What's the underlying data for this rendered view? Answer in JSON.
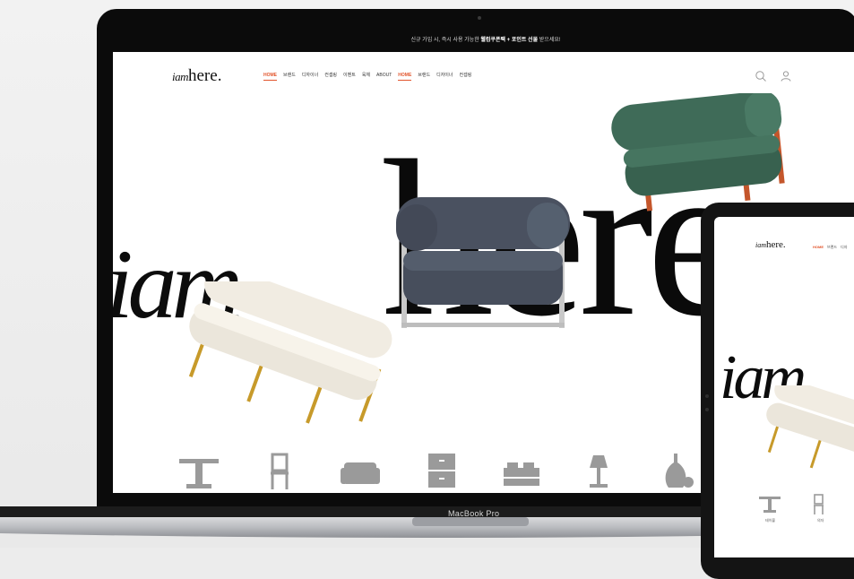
{
  "promo": {
    "text_prefix": "신규 가입 시, 즉시 사용 가능한 ",
    "text_bold": "웰컴쿠폰팩 + 포인트 선물",
    "text_suffix": " 받으세요!"
  },
  "nav": {
    "logo_script": "iam",
    "logo_serif": "here.",
    "items": [
      {
        "label": "HOME",
        "active": true
      },
      {
        "label": "브랜드",
        "active": false
      },
      {
        "label": "디자이너",
        "active": false
      },
      {
        "label": "컨셉링",
        "active": false
      },
      {
        "label": "이벤트",
        "active": false
      },
      {
        "label": "육체",
        "active": false
      },
      {
        "label": "ABOUT",
        "active": false
      },
      {
        "label": "HOME",
        "active": true
      },
      {
        "label": "브랜드",
        "active": false
      },
      {
        "label": "디자이너",
        "active": false
      },
      {
        "label": "컨셉링",
        "active": false
      }
    ],
    "icons": [
      "search-icon",
      "user-icon"
    ]
  },
  "hero": {
    "script_word": "iam",
    "big_word": "here"
  },
  "categories": [
    {
      "icon": "table-icon"
    },
    {
      "icon": "chair-icon"
    },
    {
      "icon": "sofa-icon"
    },
    {
      "icon": "cabinet-icon"
    },
    {
      "icon": "bed-icon"
    },
    {
      "icon": "lamp-icon"
    },
    {
      "icon": "vase-icon"
    }
  ],
  "device": {
    "laptop_label": "MacBook Pro"
  },
  "tablet": {
    "logo_script": "iam",
    "logo_serif": "here.",
    "menu": [
      {
        "label": "HOME",
        "active": true
      },
      {
        "label": "브랜드",
        "active": false
      },
      {
        "label": "디자",
        "active": false
      }
    ],
    "script_word": "iam",
    "categories": [
      {
        "icon": "table-icon",
        "label": "테이블"
      },
      {
        "icon": "chair-icon",
        "label": "의자"
      }
    ]
  },
  "colors": {
    "accent": "#e2552c",
    "sofa_navy": "#4a5160",
    "sofa_green": "#3f6b58",
    "frame_orange": "#c4562b",
    "bench_white": "#f1ece2",
    "gold_leg": "#c79a2a",
    "icon_gray": "#9a9a9a"
  }
}
